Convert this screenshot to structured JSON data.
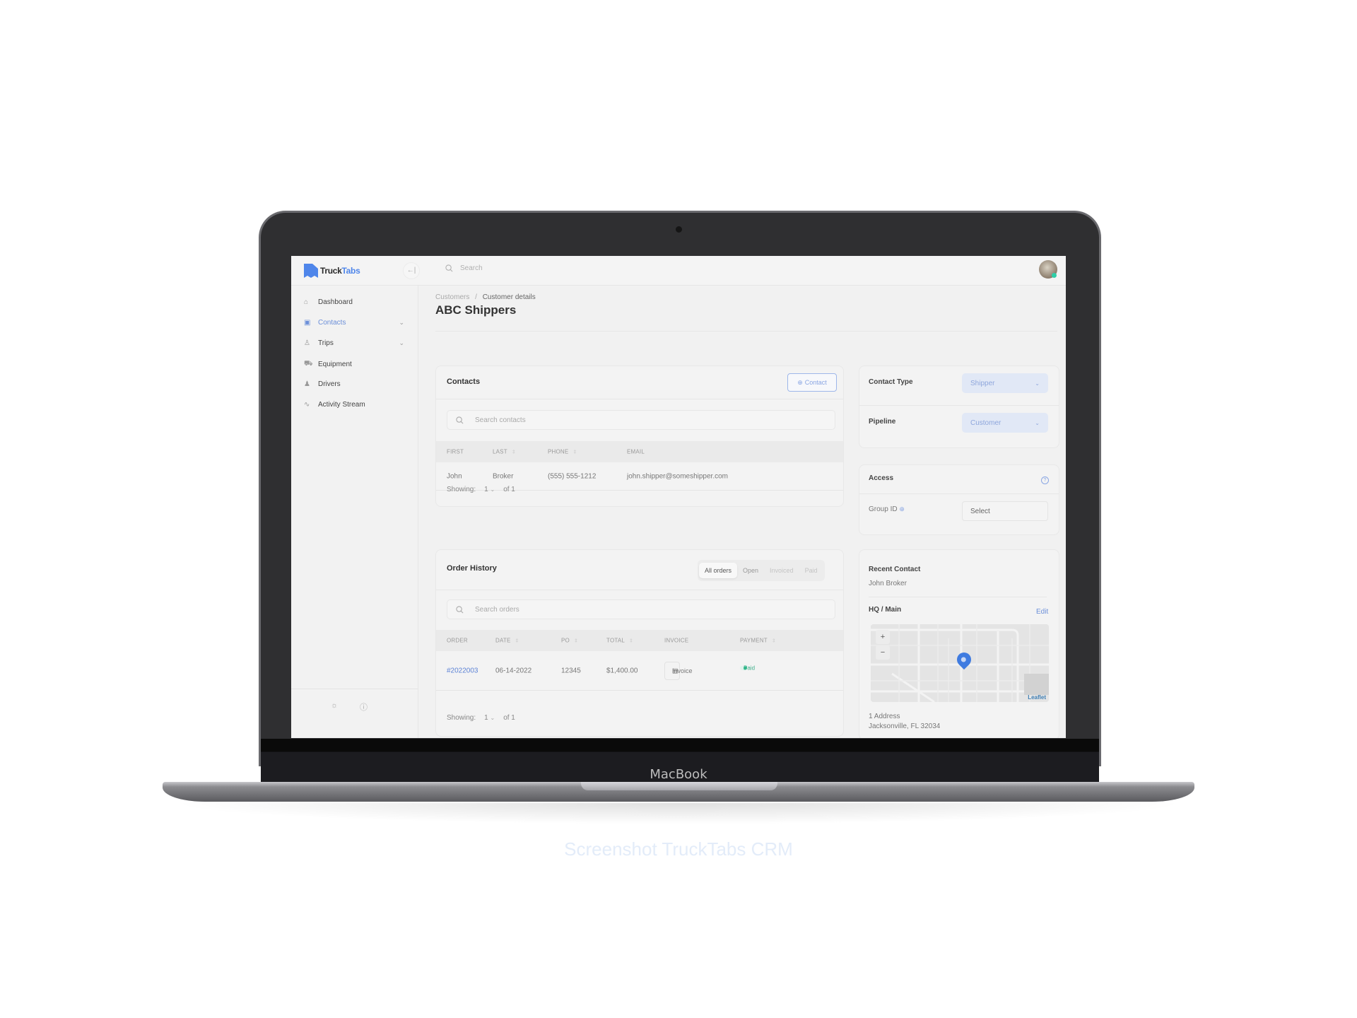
{
  "device": {
    "brand_label": "MacBook",
    "caption": "Screenshot TruckTabs CRM"
  },
  "app": {
    "logo": {
      "part1": "Truck",
      "part2": "Tabs"
    },
    "search_placeholder": "Search",
    "collapse_icon": "collapse-left-icon",
    "avatar_status_color": "#2ecfa8"
  },
  "sidebar": {
    "items": [
      {
        "label": "Dashboard",
        "icon": "home-icon",
        "has_chevron": false,
        "active": false
      },
      {
        "label": "Contacts",
        "icon": "contact-card-icon",
        "has_chevron": true,
        "active": true
      },
      {
        "label": "Trips",
        "icon": "user-pin-icon",
        "has_chevron": true,
        "active": false
      },
      {
        "label": "Equipment",
        "icon": "truck-icon",
        "has_chevron": false,
        "active": false
      },
      {
        "label": "Drivers",
        "icon": "driver-icon",
        "has_chevron": false,
        "active": false
      },
      {
        "label": "Activity Stream",
        "icon": "activity-icon",
        "has_chevron": false,
        "active": false
      }
    ],
    "footer_icons": [
      "sun-icon",
      "info-icon"
    ]
  },
  "page": {
    "breadcrumb": {
      "parent": "Customers",
      "separator": "/",
      "current": "Customer details"
    },
    "title": "ABC Shippers"
  },
  "contacts": {
    "title": "Contacts",
    "add_button": "Contact",
    "search_placeholder": "Search contacts",
    "columns": [
      "FIRST",
      "LAST",
      "PHONE",
      "EMAIL"
    ],
    "rows": [
      {
        "first": "John",
        "last": "Broker",
        "phone": "(555) 555-1212",
        "email": "john.shipper@someshipper.com"
      }
    ],
    "showing_label": "Showing:",
    "page": "1",
    "of_label": "of 1"
  },
  "orders": {
    "title": "Order History",
    "filters": [
      "All orders",
      "Open",
      "Invoiced",
      "Paid"
    ],
    "active_filter": "All orders",
    "search_placeholder": "Search orders",
    "columns": [
      "ORDER",
      "DATE",
      "PO",
      "TOTAL",
      "INVOICE",
      "PAYMENT"
    ],
    "rows": [
      {
        "order": "#2022003",
        "date": "06-14-2022",
        "po": "12345",
        "total": "$1,400.00",
        "invoice": "Invoice",
        "payment": "Paid"
      }
    ],
    "showing_label": "Showing:",
    "page": "1",
    "of_label": "of 1"
  },
  "details": {
    "contact_type_label": "Contact Type",
    "contact_type_value": "Shipper",
    "pipeline_label": "Pipeline",
    "pipeline_value": "Customer",
    "access_title": "Access",
    "group_id_label": "Group ID",
    "group_id_value": "Select",
    "recent_contact_label": "Recent Contact",
    "recent_contact_value": "John Broker",
    "hq_label": "HQ / Main",
    "edit_label": "Edit",
    "map_attribution": "Leaflet",
    "address_line1": "1 Address",
    "address_line2": "Jacksonville, FL 32034"
  },
  "colors": {
    "accent": "#4f86ea",
    "paid": "#2dbb8a",
    "select_bg": "#e1e8f6"
  }
}
